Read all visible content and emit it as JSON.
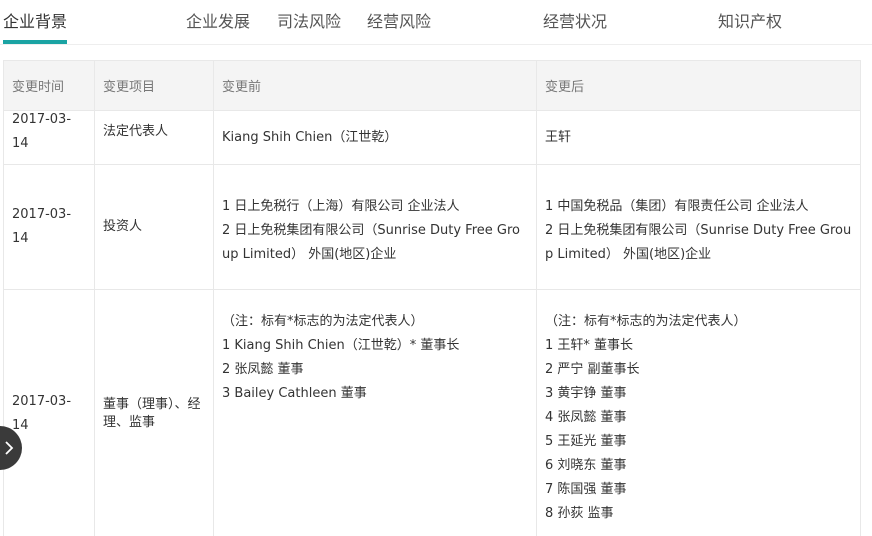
{
  "tabs": [
    {
      "label": "企业背景"
    },
    {
      "label": "企业发展"
    },
    {
      "label": "司法风险"
    },
    {
      "label": "经营风险"
    },
    {
      "label": "经营状况"
    },
    {
      "label": "知识产权"
    }
  ],
  "table": {
    "headers": [
      "变更时间",
      "变更项目",
      "变更前",
      "变更后"
    ],
    "rows": [
      {
        "date": "2017-03-14",
        "item": "法定代表人",
        "before": [
          "Kiang Shih Chien（江世乾）"
        ],
        "after": [
          "王轩"
        ]
      },
      {
        "date": "2017-03-14",
        "item": "投资人",
        "before": [
          "1 日上免税行（上海）有限公司 企业法人",
          "2 日上免税集团有限公司（Sunrise Duty Free Group Limited） 外国(地区)企业"
        ],
        "after": [
          "1 中国免税品（集团）有限责任公司 企业法人",
          "2 日上免税集团有限公司（Sunrise Duty Free Group Limited） 外国(地区)企业"
        ]
      },
      {
        "date": "2017-03-14",
        "item": "董事（理事）、经理、监事",
        "before": [
          "（注：标有*标志的为法定代表人）",
          "1 Kiang Shih Chien（江世乾）* 董事长",
          "2 张凤懿 董事",
          "3 Bailey Cathleen 董事"
        ],
        "after": [
          "（注：标有*标志的为法定代表人）",
          "1 王轩* 董事长",
          "2 严宁 副董事长",
          "3 黄宇铮 董事",
          "4 张凤懿 董事",
          "5 王延光 董事",
          "6 刘晓东 董事",
          "7 陈国强 董事",
          "8 孙荻 监事"
        ]
      }
    ]
  },
  "icons": {
    "side_arrow": "chevron-right-icon"
  }
}
